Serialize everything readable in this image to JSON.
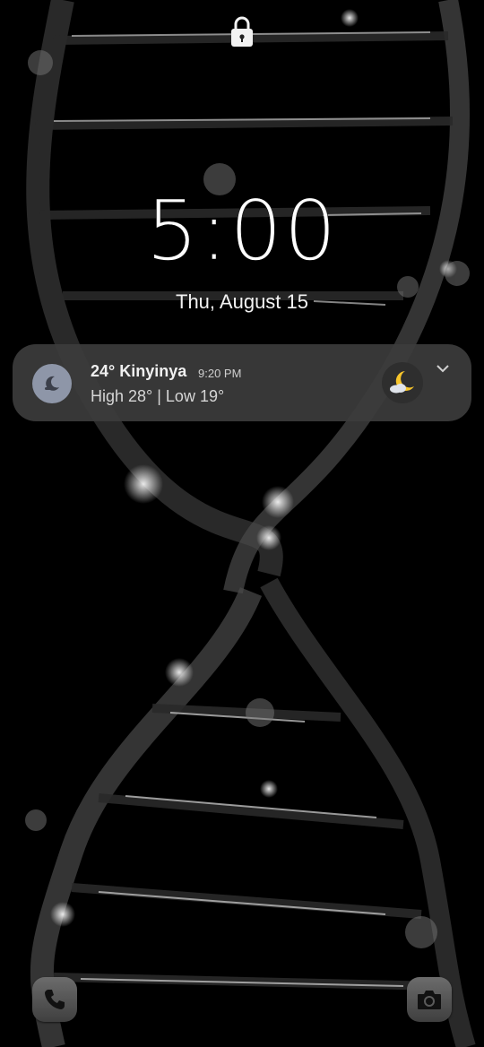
{
  "lockscreen": {
    "time": "5:00",
    "date": "Thu, August 15"
  },
  "notification": {
    "title": "24° Kinyinya",
    "time": "9:20 PM",
    "subtitle": "High 28° | Low 19°",
    "app_icon": "moon-icon",
    "weather_icon": "moon-cloud-icon",
    "accent": "#f7c52b"
  },
  "shortcuts": {
    "left": "phone-icon",
    "right": "camera-icon"
  }
}
